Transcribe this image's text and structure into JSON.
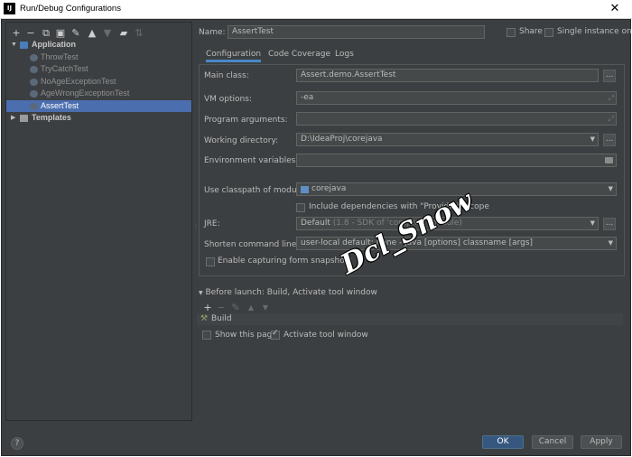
{
  "window": {
    "app_icon_text": "IJ",
    "title": "Run/Debug Configurations",
    "close_label": "✕"
  },
  "left_toolbar": {
    "icons": [
      "add-icon",
      "remove-icon",
      "copy-icon",
      "save-icon",
      "wrench-icon",
      "move-up-icon",
      "move-down-icon",
      "folder-icon",
      "sort-icon"
    ],
    "glyphs": [
      "+",
      "−",
      "⧉",
      "▣",
      "✎",
      "▲",
      "▼",
      "▰",
      "⇅"
    ]
  },
  "tree": {
    "application": {
      "label": "Application",
      "expanded_glyph": "▼"
    },
    "children": [
      "ThrowTest",
      "TryCatchTest",
      "NoAgeExceptionTest",
      "AgeWrongExceptionTest",
      "AssertTest"
    ],
    "selected": "AssertTest",
    "templates": {
      "label": "Templates",
      "collapsed_glyph": "▶"
    }
  },
  "header": {
    "name_label": "Name:",
    "name_value": "AssertTest",
    "share_label": "Share",
    "share_checked": false,
    "single_instance_label": "Single instance only",
    "single_instance_checked": false
  },
  "tabs": [
    "Configuration",
    "Code Coverage",
    "Logs"
  ],
  "active_tab": "Configuration",
  "config": {
    "main_class_label": "Main class:",
    "main_class_value": "Assert.demo.AssertTest",
    "vm_options_label": "VM options:",
    "vm_options_value": "-ea",
    "program_args_label": "Program arguments:",
    "program_args_value": "",
    "working_dir_label": "Working directory:",
    "working_dir_value": "D:\\IdeaProj\\corejava",
    "env_vars_label": "Environment variables:",
    "env_vars_value": "",
    "classpath_label": "Use classpath of module:",
    "classpath_value": "corejava",
    "include_deps_label": "Include dependencies with \"Provided\" scope",
    "include_deps_checked": false,
    "jre_label": "JRE:",
    "jre_value": "Default",
    "jre_detail": "(1.8 - SDK of 'corejava' module)",
    "shorten_label": "Shorten command line:",
    "shorten_value": "user-local default: none - java [options] classname [args]",
    "snapshots_label": "Enable capturing form snapshots",
    "snapshots_checked": false,
    "dots": "...",
    "dropdown_glyph": "▼",
    "expand_glyph": "⤢"
  },
  "before_launch": {
    "title": "Before launch: Build, Activate tool window",
    "toggle_glyph": "▼",
    "toolbar_glyphs": [
      "+",
      "−",
      "✎",
      "▲",
      "▼"
    ],
    "items": [
      "Build"
    ],
    "item_icon_glyph": "⚒",
    "show_page_label": "Show this page",
    "show_page_checked": false,
    "activate_label": "Activate tool window",
    "activate_checked": true
  },
  "footer": {
    "help_label": "?",
    "ok_label": "OK",
    "cancel_label": "Cancel",
    "apply_label": "Apply"
  },
  "watermark": "Dcl_Snow",
  "splitter_glyph": "⋮",
  "colors": {
    "background": "#3c3f41",
    "field": "#45494a",
    "selection": "#4b6eaf",
    "primary_button": "#365880",
    "tab_underline": "#4a88c7"
  }
}
